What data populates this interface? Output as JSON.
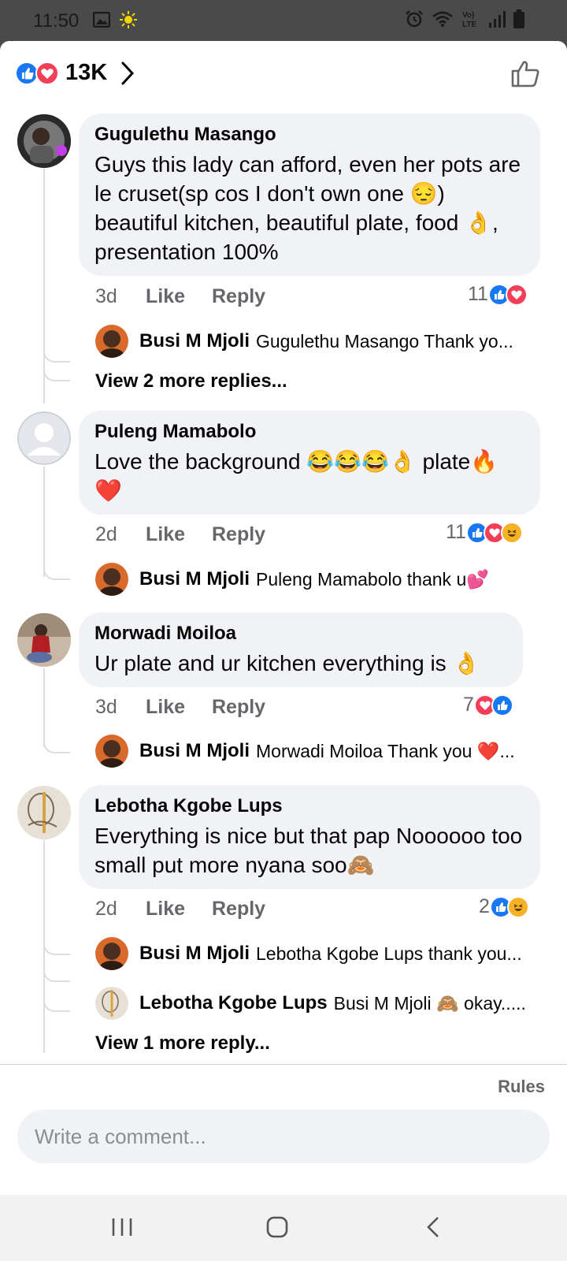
{
  "status_bar": {
    "time": "11:50",
    "left_icons": [
      "gallery-icon",
      "sun-icon"
    ],
    "right_icons": [
      "alarm-icon",
      "wifi-icon",
      "volte-icon",
      "signal-icon",
      "battery-icon"
    ],
    "volte_label": "Vo)\nLTE"
  },
  "header": {
    "reaction_count": "13K",
    "icons": [
      "like-reaction-icon",
      "love-reaction-icon",
      "chevron-right-icon",
      "thumbs-up-outline-icon"
    ]
  },
  "comments": [
    {
      "author": "Gugulethu Masango",
      "text": "Guys this lady can afford,  even her pots are le cruset(sp cos I don't own one 😔) beautiful kitchen,  beautiful plate,   food 👌, presentation 100%",
      "time": "3d",
      "like_label": "Like",
      "reply_label": "Reply",
      "reaction_count": "11",
      "reactions": [
        "like",
        "love"
      ],
      "replies": [
        {
          "author": "Busi M Mjoli",
          "text": "Gugulethu Masango Thank yo..."
        }
      ],
      "more_replies": "View 2 more replies..."
    },
    {
      "author": "Puleng Mamabolo",
      "text": "Love the background 😂😂😂👌 plate🔥❤️",
      "time": "2d",
      "like_label": "Like",
      "reply_label": "Reply",
      "reaction_count": "11",
      "reactions": [
        "like",
        "love",
        "haha"
      ],
      "replies": [
        {
          "author": "Busi M Mjoli",
          "text": "Puleng Mamabolo thank u💕"
        }
      ],
      "more_replies": ""
    },
    {
      "author": "Morwadi Moiloa",
      "text": "Ur plate and ur kitchen everything is 👌",
      "time": "3d",
      "like_label": "Like",
      "reply_label": "Reply",
      "reaction_count": "7",
      "reactions": [
        "love",
        "like"
      ],
      "replies": [
        {
          "author": "Busi M Mjoli",
          "text": "Morwadi Moiloa Thank you ❤️..."
        }
      ],
      "more_replies": ""
    },
    {
      "author": "Lebotha Kgobe Lups",
      "text": "Everything is nice but that pap Noooooo too small put more nyana soo🙈",
      "time": "2d",
      "like_label": "Like",
      "reply_label": "Reply",
      "reaction_count": "2",
      "reactions": [
        "like",
        "haha"
      ],
      "replies": [
        {
          "author": "Busi M Mjoli",
          "text": "Lebotha Kgobe Lups thank you..."
        },
        {
          "author": "Lebotha Kgobe Lups",
          "text": "Busi M Mjoli 🙈 okay....."
        }
      ],
      "more_replies": "View 1 more reply..."
    }
  ],
  "footer": {
    "rules_label": "Rules",
    "composer_placeholder": "Write a comment..."
  },
  "nav_bar": {
    "buttons": [
      "recent-apps-icon",
      "home-icon",
      "back-icon"
    ]
  },
  "colors": {
    "like_blue": "#1877f2",
    "love_red": "#f33e58",
    "haha_yellow": "#f7b125",
    "bubble_gray": "#f0f2f5",
    "meta_gray": "#65676b"
  }
}
